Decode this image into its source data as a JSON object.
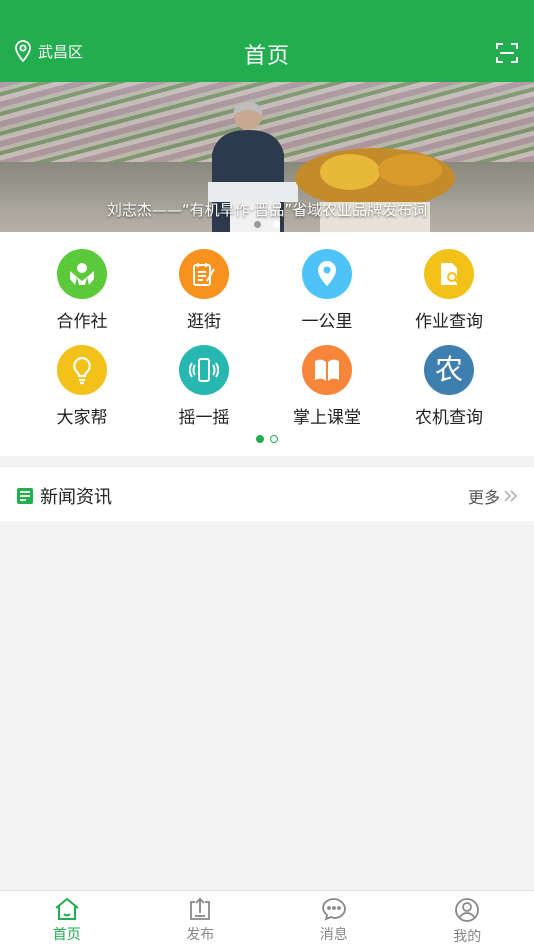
{
  "header": {
    "location": "武昌区",
    "title": "首页"
  },
  "banner": {
    "caption": "刘志杰——“有机旱作·晋品”省域农业品牌发布词",
    "page_count": 2,
    "active_page": 2
  },
  "grid": {
    "items": [
      {
        "label": "合作社",
        "color": "#5cc93a",
        "icon": "hands-icon"
      },
      {
        "label": "逛街",
        "color": "#f7921e",
        "icon": "notepad-icon"
      },
      {
        "label": "一公里",
        "color": "#4ec3f7",
        "icon": "location-pin-icon"
      },
      {
        "label": "作业查询",
        "color": "#f2c21a",
        "icon": "document-search-icon"
      },
      {
        "label": "大家帮",
        "color": "#f2c21a",
        "icon": "lightbulb-icon"
      },
      {
        "label": "摇一摇",
        "color": "#25b7b0",
        "icon": "phone-shake-icon"
      },
      {
        "label": "掌上课堂",
        "color": "#f7863a",
        "icon": "book-icon"
      },
      {
        "label": "农机查询",
        "color": "#3f7fb0",
        "icon": "nong-character-icon",
        "glyph": "农"
      }
    ],
    "pager": {
      "count": 2,
      "active": 1
    }
  },
  "news": {
    "title": "新闻资讯",
    "more": "更多"
  },
  "tabbar": {
    "items": [
      {
        "label": "首页",
        "icon": "home-icon",
        "active": true
      },
      {
        "label": "发布",
        "icon": "upload-icon",
        "active": false
      },
      {
        "label": "消息",
        "icon": "chat-icon",
        "active": false
      },
      {
        "label": "我的",
        "icon": "user-icon",
        "active": false
      }
    ]
  },
  "colors": {
    "brand": "#22ad4f",
    "background": "#f3f3f3"
  }
}
